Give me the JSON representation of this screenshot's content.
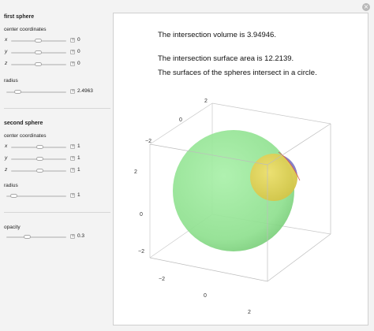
{
  "first_sphere": {
    "title": "first sphere",
    "center_label": "center coordinates",
    "x_label": "x",
    "x_value": "0",
    "y_label": "y",
    "y_value": "0",
    "z_label": "z",
    "z_value": "0",
    "radius_label": "radius",
    "radius_value": "2.4963"
  },
  "second_sphere": {
    "title": "second sphere",
    "center_label": "center coordinates",
    "x_label": "x",
    "x_value": "1",
    "y_label": "y",
    "y_value": "1",
    "z_label": "z",
    "z_value": "1",
    "radius_label": "radius",
    "radius_value": "1"
  },
  "opacity": {
    "label": "opacity",
    "value": "0.3"
  },
  "output": {
    "volume_text": "The intersection volume is 3.94946.",
    "area_text": "The intersection surface area is 12.2139.",
    "relation_text": "The surfaces of the spheres intersect in a circle."
  },
  "plot": {
    "axis_ticks": {
      "top_back": [
        "2",
        "0",
        "−2"
      ],
      "left_vertical": [
        "2",
        "0",
        "−2"
      ],
      "bottom_front": [
        "−2",
        "0",
        "2"
      ]
    },
    "colors": {
      "big_sphere": "#8fe08f",
      "small_sphere": "#e6d24a",
      "intersection": "#7a78d8",
      "box": "#bdbdbd"
    }
  },
  "icons": {
    "close": "close-icon",
    "plus": "plus-icon"
  }
}
